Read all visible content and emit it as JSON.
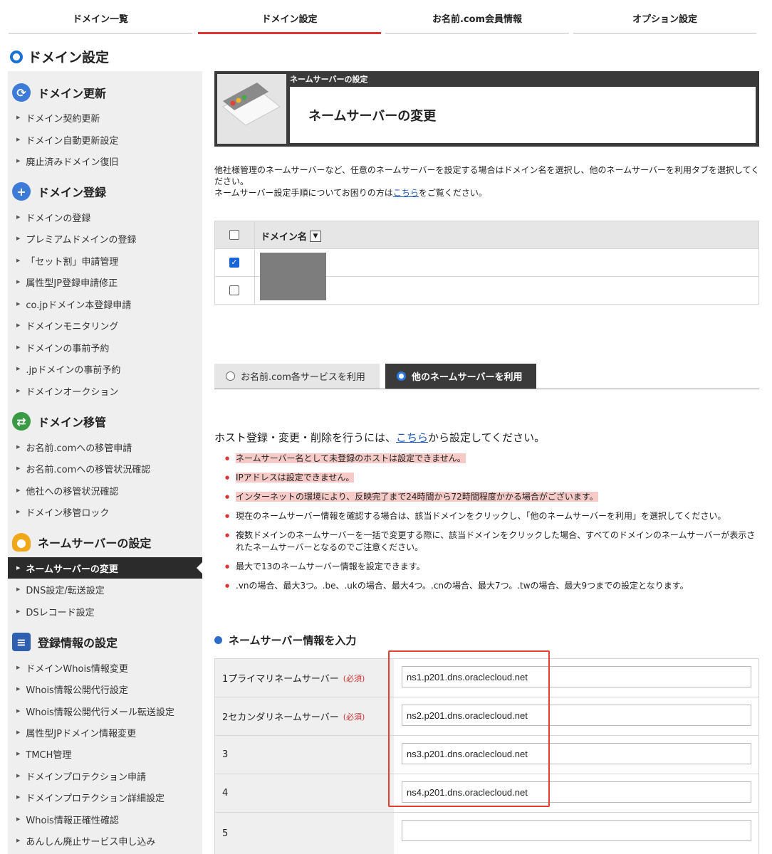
{
  "topnav": {
    "tabs": [
      {
        "label": "ドメイン一覧"
      },
      {
        "label": "ドメイン設定"
      },
      {
        "label": "お名前.com会員情報"
      },
      {
        "label": "オプション設定"
      }
    ]
  },
  "page_title": "ドメイン設定",
  "sidebar": {
    "sections": [
      {
        "title": "ドメイン更新",
        "items": [
          "ドメイン契約更新",
          "ドメイン自動更新設定",
          "廃止済みドメイン復旧"
        ]
      },
      {
        "title": "ドメイン登録",
        "items": [
          "ドメインの登録",
          "プレミアムドメインの登録",
          "「セット割」申請管理",
          "属性型JP登録申請修正",
          "co.jpドメイン本登録申請",
          "ドメインモニタリング",
          "ドメインの事前予約",
          ".jpドメインの事前予約",
          "ドメインオークション"
        ]
      },
      {
        "title": "ドメイン移管",
        "items": [
          "お名前.comへの移管申請",
          "お名前.comへの移管状況確認",
          "他社への移管状況確認",
          "ドメイン移管ロック"
        ]
      },
      {
        "title": "ネームサーバーの設定",
        "items": [
          "ネームサーバーの変更",
          "DNS設定/転送設定",
          "DSレコード設定"
        ]
      },
      {
        "title": "登録情報の設定",
        "items": [
          "ドメインWhois情報変更",
          "Whois情報公開代行設定",
          "Whois情報公開代行メール転送設定",
          "属性型JPドメイン情報変更",
          "TMCH管理",
          "ドメインプロテクション申請",
          "ドメインプロテクション詳細設定",
          "Whois情報正確性確認",
          "あんしん廃止サービス申し込み"
        ]
      }
    ]
  },
  "header": {
    "caption": "ネームサーバーの設定",
    "title": "ネームサーバーの変更"
  },
  "description": {
    "line1": "他社様管理のネームサーバーなど、任意のネームサーバーを設定する場合はドメイン名を選択し、他のネームサーバーを利用タブを選択してください。",
    "line2_pre": "ネームサーバー設定手順についてお困りの方は",
    "line2_link": "こちら",
    "line2_post": "をご覧ください。"
  },
  "domain_table": {
    "header": "ドメイン名",
    "sort_icon": "▼",
    "rows": [
      {
        "checked": true
      },
      {
        "checked": false
      }
    ]
  },
  "ns_tabs": {
    "onamae": "お名前.com各サービスを利用",
    "other": "他のネームサーバーを利用"
  },
  "host": {
    "pre": "ホスト登録・変更・削除を行うには、",
    "link": "こちら",
    "post": "から設定してください。"
  },
  "notes": [
    "ネームサーバー名として未登録のホストは設定できません。",
    "IPアドレスは設定できません。",
    "インターネットの環境により、反映完了まで24時間から72時間程度かかる場合がございます。",
    "現在のネームサーバー情報を確認する場合は、該当ドメインをクリックし、「他のネームサーバーを利用」を選択してください。",
    "複数ドメインのネームサーバーを一括で変更する際に、該当ドメインをクリックした場合、すべてのドメインのネームサーバーが表示されたネームサーバーとなるのでご注意ください。",
    "最大で13のネームサーバー情報を設定できます。",
    ".vnの場合、最大3つ。.be、.ukの場合、最大4つ。.cnの場合、最大7つ。.twの場合、最大9つまでの設定となります。"
  ],
  "input_section": {
    "title": "ネームサーバー情報を入力",
    "required": "(必須)",
    "rows": [
      {
        "label": "1プライマリネームサーバー",
        "value": "ns1.p201.dns.oraclecloud.net"
      },
      {
        "label": "2セカンダリネームサーバー",
        "value": "ns2.p201.dns.oraclecloud.net"
      },
      {
        "label": "3",
        "value": "ns3.p201.dns.oraclecloud.net"
      },
      {
        "label": "4",
        "value": "ns4.p201.dns.oraclecloud.net"
      },
      {
        "label": "5",
        "value": ""
      }
    ]
  },
  "colors": {
    "accent": "#dd3333",
    "dark": "#3a3a3a",
    "link": "#1f58b5",
    "highlight": "#f6cbc7"
  }
}
